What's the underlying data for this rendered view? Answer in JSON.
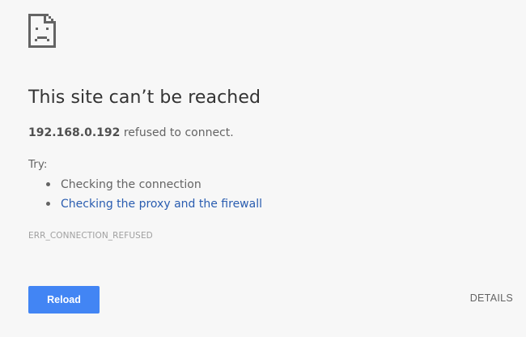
{
  "icon": "sad-page-icon",
  "title": "This site can’t be reached",
  "summary": {
    "host": "192.168.0.192",
    "message": " refused to connect."
  },
  "suggestions": {
    "label": "Try:",
    "items": [
      {
        "text": "Checking the connection",
        "link": false
      },
      {
        "text": "Checking the proxy and the firewall",
        "link": true
      }
    ]
  },
  "error_code": "ERR_CONNECTION_REFUSED",
  "buttons": {
    "reload": "Reload",
    "details": "DETAILS"
  },
  "colors": {
    "background": "#f7f7f7",
    "primary_button": "#4285f4",
    "link": "#2a5db0",
    "text": "#646464"
  }
}
